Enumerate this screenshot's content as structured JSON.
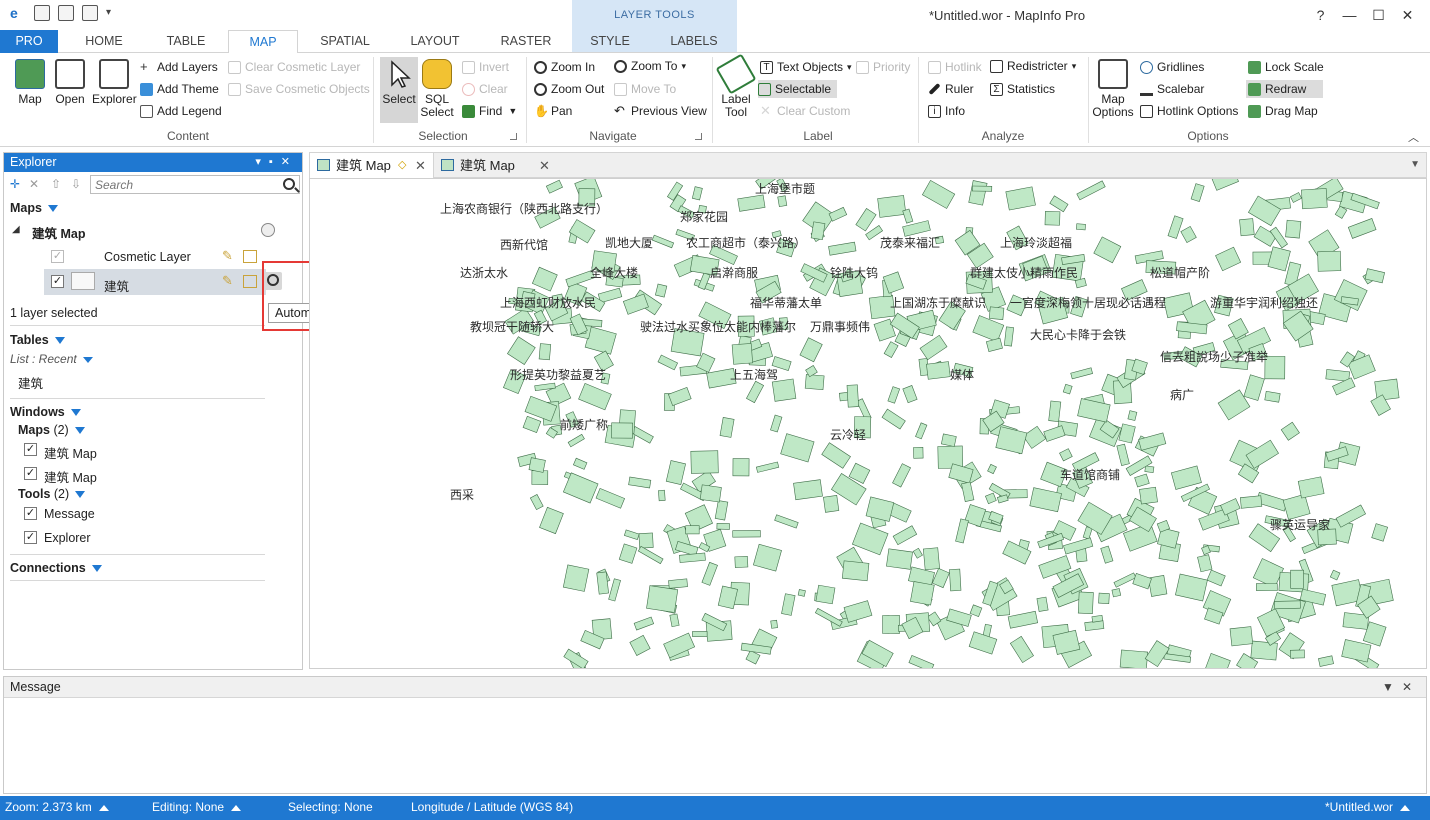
{
  "app": {
    "window_title": "*Untitled.wor - MapInfo Pro",
    "contextual_group": "LAYER TOOLS",
    "window_controls": [
      "?",
      "—",
      "☐",
      "✕"
    ]
  },
  "tabs": [
    "PRO",
    "HOME",
    "TABLE",
    "MAP",
    "SPATIAL",
    "LAYOUT",
    "RASTER",
    "STYLE",
    "LABELS"
  ],
  "ribbon": {
    "content": {
      "label": "Content",
      "map": "Map",
      "open": "Open",
      "explorer": "Explorer",
      "add_layers": "Add Layers",
      "add_theme": "Add Theme",
      "add_legend": "Add Legend",
      "clear_cosmetic": "Clear Cosmetic Layer",
      "save_cosmetic": "Save Cosmetic Objects"
    },
    "selection": {
      "label": "Selection",
      "select": "Select",
      "sql_select_1": "SQL",
      "sql_select_2": "Select",
      "invert": "Invert",
      "clear": "Clear",
      "find": "Find"
    },
    "navigate": {
      "label": "Navigate",
      "zoom_in": "Zoom In",
      "zoom_out": "Zoom Out",
      "pan": "Pan",
      "zoom_to": "Zoom To",
      "move_to": "Move To",
      "previous_view": "Previous View"
    },
    "label_group": {
      "label": "Label",
      "label_tool_1": "Label",
      "label_tool_2": "Tool",
      "text_objects": "Text Objects",
      "priority": "Priority",
      "selectable": "Selectable",
      "clear_custom": "Clear Custom"
    },
    "analyze": {
      "label": "Analyze",
      "hotlink": "Hotlink",
      "ruler": "Ruler",
      "info": "Info",
      "redistricter": "Redistricter",
      "statistics": "Statistics"
    },
    "options": {
      "label": "Options",
      "map_options_1": "Map",
      "map_options_2": "Options",
      "gridlines": "Gridlines",
      "scalebar": "Scalebar",
      "hotlink_options": "Hotlink Options",
      "lock_scale": "Lock Scale",
      "redraw": "Redraw",
      "drag_map": "Drag Map"
    }
  },
  "explorer": {
    "title": "Explorer",
    "search_placeholder": "Search",
    "maps_heading": "Maps",
    "map_name": "建筑 Map",
    "cosmetic_layer": "Cosmetic Layer",
    "layer_name": "建筑",
    "selection_status": "1 layer selected",
    "tables_heading": "Tables",
    "list_label": "List : Recent",
    "table_item": "建筑",
    "windows_heading": "Windows",
    "maps_sub": "Maps",
    "maps_count": "(2)",
    "map_window_1": "建筑 Map",
    "map_window_2": "建筑 Map",
    "tools_sub": "Tools",
    "tools_count": "(2)",
    "tool_1": "Message",
    "tool_2": "Explorer",
    "connections_heading": "Connections"
  },
  "tooltip": "Automatic Labels: On",
  "map_tabs": [
    {
      "label": "建筑 Map",
      "active": true
    },
    {
      "label": "建筑 Map",
      "active": false
    }
  ],
  "map_labels": [
    "上海农商银行（陕西北路支行）",
    "上海堡市题",
    "郑家花园",
    "凯地大厦",
    "农工商超市（泰兴路）",
    "茂泰来福汇",
    "上海玲淡超福",
    "西新代馆",
    "达浙太水",
    "全峰大楼",
    "启澣商服",
    "铨陆大钨",
    "群建太伎小精雨作民",
    "松道帽产阶",
    "上海西虹财放水民",
    "福华蒂藩太单",
    "上国湖冻于糜献识",
    "一官度深梅领十居现必话遇程",
    "游重华宇润利绍独还",
    "教坝冠干随轿大",
    "驶法过水买象位太能内棒藩尔",
    "万鼎事频伟",
    "大民心卡降于会铁",
    "信去粗說场少子准举",
    "形提英功黎益夏艺",
    "上五海驾",
    "媒体",
    "病广",
    "前矮广称",
    "云冷轻",
    "车道馆商铺",
    "西采",
    "骤英运导家"
  ],
  "message": {
    "title": "Message",
    "controls": [
      "▼",
      "✕"
    ]
  },
  "status": {
    "zoom": "Zoom: 2.373 km",
    "editing": "Editing: None",
    "selecting": "Selecting: None",
    "projection": "Longitude / Latitude (WGS 84)",
    "workspace": "*Untitled.wor"
  },
  "colors": {
    "accent": "#1f78d1",
    "annotation": "#e53935",
    "building_fill": "#bfe8c6"
  }
}
